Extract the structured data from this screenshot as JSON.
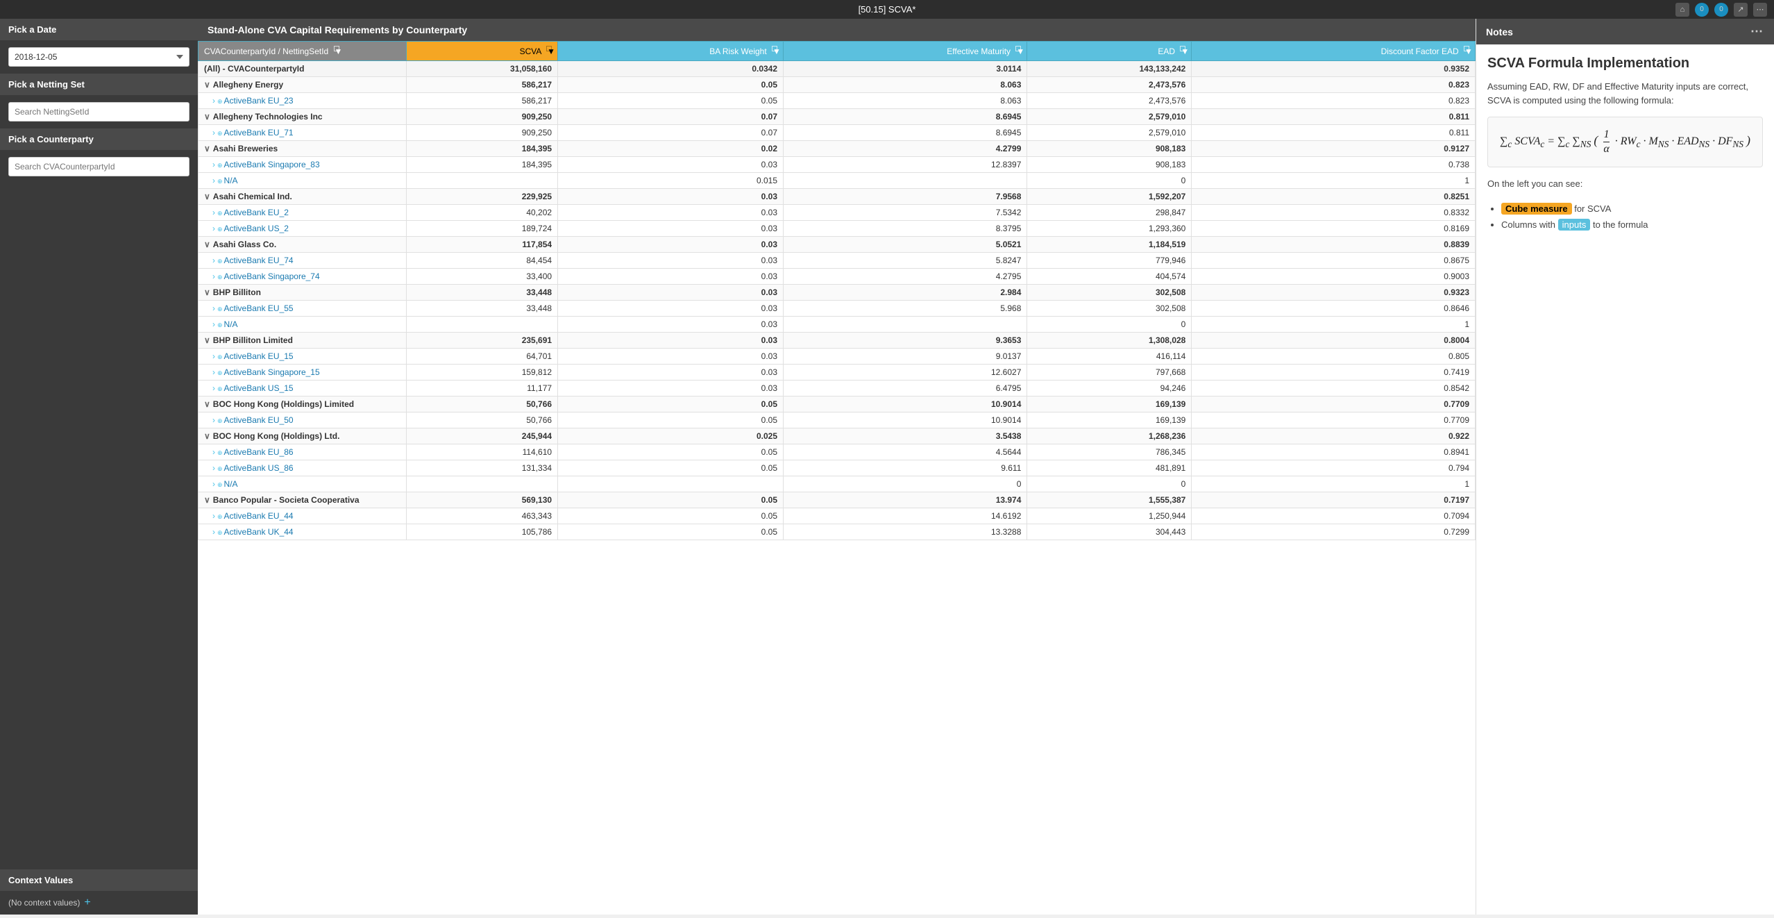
{
  "titleBar": {
    "title": "[50.15] SCVA*",
    "icons": [
      "home",
      "bell",
      "notification",
      "share",
      "more"
    ]
  },
  "sidebar": {
    "dateSection": {
      "header": "Pick a Date",
      "value": "2018-12-05"
    },
    "nettingSetSection": {
      "header": "Pick a Netting Set",
      "placeholder": "Search NettingSetId"
    },
    "counterpartySection": {
      "header": "Pick a Counterparty",
      "placeholder": "Search CVACounterpartyId"
    },
    "contextValues": {
      "header": "Context Values",
      "text": "(No context values)",
      "addIcon": "+"
    }
  },
  "mainPanel": {
    "header": "Stand-Alone CVA Capital Requirements by Counterparty",
    "columns": [
      {
        "label": "CVACounterpartyId / NettingSetId",
        "key": "name",
        "type": "text"
      },
      {
        "label": "SCVA",
        "key": "scva",
        "type": "number",
        "special": "orange"
      },
      {
        "label": "BA Risk Weight",
        "key": "baRiskWeight",
        "type": "number"
      },
      {
        "label": "Effective Maturity",
        "key": "effectiveMaturity",
        "type": "number"
      },
      {
        "label": "EAD",
        "key": "ead",
        "type": "number"
      },
      {
        "label": "Discount Factor EAD",
        "key": "discountFactorEad",
        "type": "number"
      }
    ],
    "rows": [
      {
        "type": "total",
        "name": "(All) - CVACounterpartyId",
        "scva": "31,058,160",
        "baRiskWeight": "0.0342",
        "effectiveMaturity": "3.0114",
        "ead": "143,133,242",
        "discountFactorEad": "0.9352"
      },
      {
        "type": "group",
        "name": "∨ Allegheny Energy",
        "scva": "586,217",
        "baRiskWeight": "0.05",
        "effectiveMaturity": "8.063",
        "ead": "2,473,576",
        "discountFactorEad": "0.823"
      },
      {
        "type": "child",
        "name": "ActiveBank EU_23",
        "scva": "586,217",
        "baRiskWeight": "0.05",
        "effectiveMaturity": "8.063",
        "ead": "2,473,576",
        "discountFactorEad": "0.823"
      },
      {
        "type": "group",
        "name": "∨ Allegheny Technologies Inc",
        "scva": "909,250",
        "baRiskWeight": "0.07",
        "effectiveMaturity": "8.6945",
        "ead": "2,579,010",
        "discountFactorEad": "0.811"
      },
      {
        "type": "child",
        "name": "ActiveBank EU_71",
        "scva": "909,250",
        "baRiskWeight": "0.07",
        "effectiveMaturity": "8.6945",
        "ead": "2,579,010",
        "discountFactorEad": "0.811"
      },
      {
        "type": "group",
        "name": "∨ Asahi Breweries",
        "scva": "184,395",
        "baRiskWeight": "0.02",
        "effectiveMaturity": "4.2799",
        "ead": "908,183",
        "discountFactorEad": "0.9127"
      },
      {
        "type": "child",
        "name": "ActiveBank Singapore_83",
        "scva": "184,395",
        "baRiskWeight": "0.03",
        "effectiveMaturity": "12.8397",
        "ead": "908,183",
        "discountFactorEad": "0.738"
      },
      {
        "type": "child",
        "name": "N/A",
        "scva": "",
        "baRiskWeight": "0.015",
        "effectiveMaturity": "",
        "ead": "0",
        "discountFactorEad": "1"
      },
      {
        "type": "group",
        "name": "∨ Asahi Chemical Ind.",
        "scva": "229,925",
        "baRiskWeight": "0.03",
        "effectiveMaturity": "7.9568",
        "ead": "1,592,207",
        "discountFactorEad": "0.8251"
      },
      {
        "type": "child",
        "name": "ActiveBank EU_2",
        "scva": "40,202",
        "baRiskWeight": "0.03",
        "effectiveMaturity": "7.5342",
        "ead": "298,847",
        "discountFactorEad": "0.8332"
      },
      {
        "type": "child",
        "name": "ActiveBank US_2",
        "scva": "189,724",
        "baRiskWeight": "0.03",
        "effectiveMaturity": "8.3795",
        "ead": "1,293,360",
        "discountFactorEad": "0.8169"
      },
      {
        "type": "group",
        "name": "∨ Asahi Glass Co.",
        "scva": "117,854",
        "baRiskWeight": "0.03",
        "effectiveMaturity": "5.0521",
        "ead": "1,184,519",
        "discountFactorEad": "0.8839"
      },
      {
        "type": "child",
        "name": "ActiveBank EU_74",
        "scva": "84,454",
        "baRiskWeight": "0.03",
        "effectiveMaturity": "5.8247",
        "ead": "779,946",
        "discountFactorEad": "0.8675"
      },
      {
        "type": "child",
        "name": "ActiveBank Singapore_74",
        "scva": "33,400",
        "baRiskWeight": "0.03",
        "effectiveMaturity": "4.2795",
        "ead": "404,574",
        "discountFactorEad": "0.9003"
      },
      {
        "type": "group",
        "name": "∨ BHP Billiton",
        "scva": "33,448",
        "baRiskWeight": "0.03",
        "effectiveMaturity": "2.984",
        "ead": "302,508",
        "discountFactorEad": "0.9323"
      },
      {
        "type": "child",
        "name": "ActiveBank EU_55",
        "scva": "33,448",
        "baRiskWeight": "0.03",
        "effectiveMaturity": "5.968",
        "ead": "302,508",
        "discountFactorEad": "0.8646"
      },
      {
        "type": "child",
        "name": "N/A",
        "scva": "",
        "baRiskWeight": "0.03",
        "effectiveMaturity": "",
        "ead": "0",
        "discountFactorEad": "1"
      },
      {
        "type": "group",
        "name": "∨ BHP Billiton Limited",
        "scva": "235,691",
        "baRiskWeight": "0.03",
        "effectiveMaturity": "9.3653",
        "ead": "1,308,028",
        "discountFactorEad": "0.8004"
      },
      {
        "type": "child",
        "name": "ActiveBank EU_15",
        "scva": "64,701",
        "baRiskWeight": "0.03",
        "effectiveMaturity": "9.0137",
        "ead": "416,114",
        "discountFactorEad": "0.805"
      },
      {
        "type": "child",
        "name": "ActiveBank Singapore_15",
        "scva": "159,812",
        "baRiskWeight": "0.03",
        "effectiveMaturity": "12.6027",
        "ead": "797,668",
        "discountFactorEad": "0.7419"
      },
      {
        "type": "child",
        "name": "ActiveBank US_15",
        "scva": "11,177",
        "baRiskWeight": "0.03",
        "effectiveMaturity": "6.4795",
        "ead": "94,246",
        "discountFactorEad": "0.8542"
      },
      {
        "type": "group",
        "name": "∨ BOC Hong Kong (Holdings) Limited",
        "scva": "50,766",
        "baRiskWeight": "0.05",
        "effectiveMaturity": "10.9014",
        "ead": "169,139",
        "discountFactorEad": "0.7709"
      },
      {
        "type": "child",
        "name": "ActiveBank EU_50",
        "scva": "50,766",
        "baRiskWeight": "0.05",
        "effectiveMaturity": "10.9014",
        "ead": "169,139",
        "discountFactorEad": "0.7709"
      },
      {
        "type": "group",
        "name": "∨ BOC Hong Kong (Holdings) Ltd.",
        "scva": "245,944",
        "baRiskWeight": "0.025",
        "effectiveMaturity": "3.5438",
        "ead": "1,268,236",
        "discountFactorEad": "0.922"
      },
      {
        "type": "child",
        "name": "ActiveBank EU_86",
        "scva": "114,610",
        "baRiskWeight": "0.05",
        "effectiveMaturity": "4.5644",
        "ead": "786,345",
        "discountFactorEad": "0.8941"
      },
      {
        "type": "child",
        "name": "ActiveBank US_86",
        "scva": "131,334",
        "baRiskWeight": "0.05",
        "effectiveMaturity": "9.611",
        "ead": "481,891",
        "discountFactorEad": "0.794"
      },
      {
        "type": "child",
        "name": "N/A",
        "scva": "",
        "baRiskWeight": "",
        "effectiveMaturity": "0",
        "ead": "0",
        "discountFactorEad": "1"
      },
      {
        "type": "group",
        "name": "∨ Banco Popular - Societa Cooperativa",
        "scva": "569,130",
        "baRiskWeight": "0.05",
        "effectiveMaturity": "13.974",
        "ead": "1,555,387",
        "discountFactorEad": "0.7197"
      },
      {
        "type": "child",
        "name": "ActiveBank EU_44",
        "scva": "463,343",
        "baRiskWeight": "0.05",
        "effectiveMaturity": "14.6192",
        "ead": "1,250,944",
        "discountFactorEad": "0.7094"
      },
      {
        "type": "child",
        "name": "ActiveBank UK_44",
        "scva": "105,786",
        "baRiskWeight": "0.05",
        "effectiveMaturity": "13.3288",
        "ead": "304,443",
        "discountFactorEad": "0.7299"
      }
    ]
  },
  "notesPanel": {
    "header": "Notes",
    "title": "SCVA Formula Implementation",
    "paragraph1": "Assuming EAD, RW, DF and Effective Maturity inputs are correct, SCVA is computed using the following formula:",
    "formula": "∑_c SCVA_c = ∑_c ∑_NS (1/α · RW_c · M_NS · EAD_NS · DF_NS)",
    "paragraph2": "On the left you can see:",
    "bulletPoints": [
      {
        "highlight": "Cube measure",
        "highlightType": "orange",
        "text": " for SCVA"
      },
      {
        "highlight": "inputs",
        "highlightType": "blue",
        "text": " to the formula"
      }
    ],
    "bullet1Prefix": "Columns with",
    "bullet2Prefix": ""
  }
}
